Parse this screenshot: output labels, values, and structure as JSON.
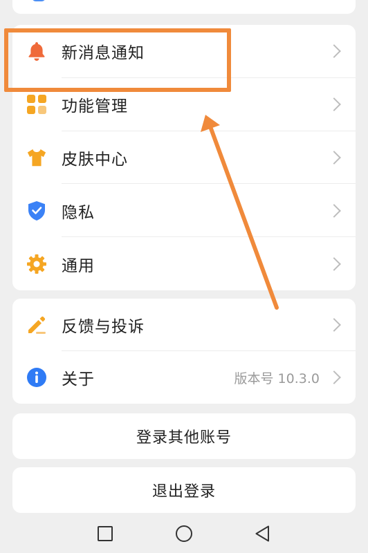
{
  "settings": {
    "items": [
      {
        "label": "新消息通知",
        "icon": "bell-icon"
      },
      {
        "label": "功能管理",
        "icon": "grid-icon"
      },
      {
        "label": "皮肤中心",
        "icon": "tshirt-icon"
      },
      {
        "label": "隐私",
        "icon": "shield-icon"
      },
      {
        "label": "通用",
        "icon": "gear-icon"
      }
    ]
  },
  "support": {
    "items": [
      {
        "label": "反馈与投诉",
        "icon": "edit-icon"
      },
      {
        "label": "关于",
        "icon": "info-icon",
        "value": "版本号 10.3.0"
      }
    ]
  },
  "buttons": {
    "other_account": "登录其他账号",
    "logout": "退出登录"
  },
  "colors": {
    "accent_orange": "#f08a3b",
    "bell": "#ef6a3a",
    "grid": "#f5a623",
    "tshirt": "#f5a623",
    "shield": "#3b82f6",
    "gear": "#f5a623",
    "edit": "#f5a623",
    "info": "#2f7bf5"
  }
}
